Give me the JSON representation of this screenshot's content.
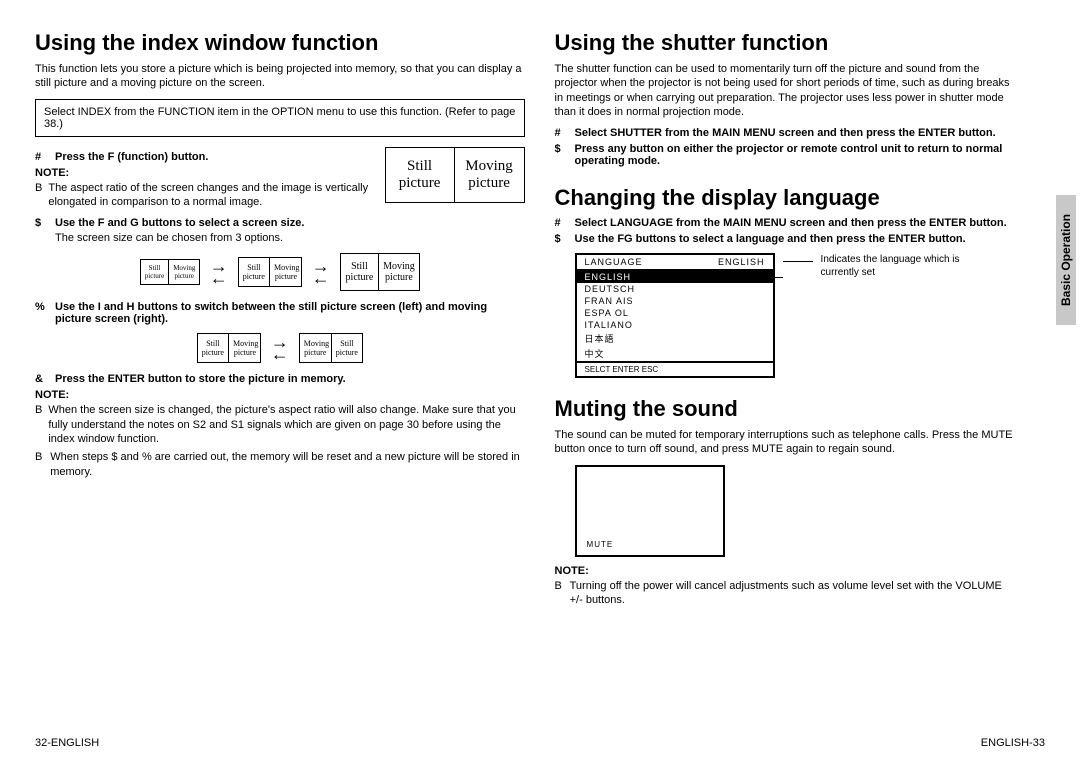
{
  "left": {
    "title": "Using the index window function",
    "intro": "This function lets you store a picture which is being projected into memory, so that you can display a still picture and a moving picture on the screen.",
    "boxed": "Select INDEX from the FUNCTION item in the OPTION menu to use this function. (Refer to page 38.)",
    "step1": {
      "marker": "#",
      "text": "Press the F (function) button.",
      "note_label": "NOTE:",
      "note_bullet": "B",
      "note_text": "The aspect ratio of the screen changes and the image is vertically elongated in comparison to a normal image."
    },
    "step2": {
      "marker": "$",
      "text": "Use the F  and G  buttons to select a screen size.",
      "sub": "The screen size can be chosen from 3 options."
    },
    "step3": {
      "marker": "%",
      "text": "Use the I    and H  buttons to switch between the still picture screen (left) and moving picture screen (right)."
    },
    "step4": {
      "marker": "&",
      "text": "Press the ENTER button to store the picture in memory."
    },
    "final_note_label": "NOTE:",
    "final_notes": [
      {
        "bullet": "B",
        "text": "When the screen size is changed, the picture's aspect ratio will also change. Make sure that you fully understand the notes on S2 and S1 signals which are given on page 30 before using the index window function."
      },
      {
        "bullet": "B",
        "text": "When steps $  and % are carried out, the memory will be reset and a new picture will be stored in memory."
      }
    ],
    "pic": {
      "still": "Still picture",
      "moving": "Moving picture",
      "still_s": "Still",
      "moving_s": "Moving",
      "picture": "picture"
    }
  },
  "right": {
    "shutter": {
      "title": "Using the shutter function",
      "intro": "The shutter function can be used to momentarily turn off the picture and sound from the projector when the projector is not being used for short periods of time, such as during breaks in meetings or when carrying out preparation. The projector uses less power in shutter mode than it does in normal projection mode.",
      "step1": {
        "marker": "#",
        "text": "Select SHUTTER from the MAIN MENU screen and then press the ENTER button."
      },
      "step2": {
        "marker": "$",
        "text": "Press any button on either the projector or remote control unit to return to normal operating mode."
      }
    },
    "language": {
      "title": "Changing the display language",
      "step1": {
        "marker": "#",
        "text": "Select LANGUAGE from the MAIN MENU screen and then press the ENTER button."
      },
      "step2": {
        "marker": "$",
        "text": "Use the FG  buttons to select a language and then press the ENTER button."
      },
      "menu": {
        "title_left": "LANGUAGE",
        "title_right": "ENGLISH",
        "items": [
          "ENGLISH",
          "DEUTSCH",
          "FRAN   AIS",
          "ESPA  OL",
          "ITALIANO",
          "日本語",
          "中文"
        ],
        "footer": "  SELCT   ENTER   ESC"
      },
      "callout": "Indicates the language which is currently set"
    },
    "muting": {
      "title": "Muting the sound",
      "intro": "The sound can be muted for temporary interruptions such as telephone calls. Press the MUTE button once to turn off sound, and press MUTE again to regain sound.",
      "mute_label": "MUTE",
      "note_label": "NOTE:",
      "note_bullet": "B",
      "note_text": "Turning off the power will cancel adjustments such as volume level set with the VOLUME +/- buttons."
    }
  },
  "side_tab": "Basic Operation",
  "footer_left_num": "32-",
  "footer_left_lang": "ENGLISH",
  "footer_right_lang": "ENGLISH",
  "footer_right_num": "-33"
}
